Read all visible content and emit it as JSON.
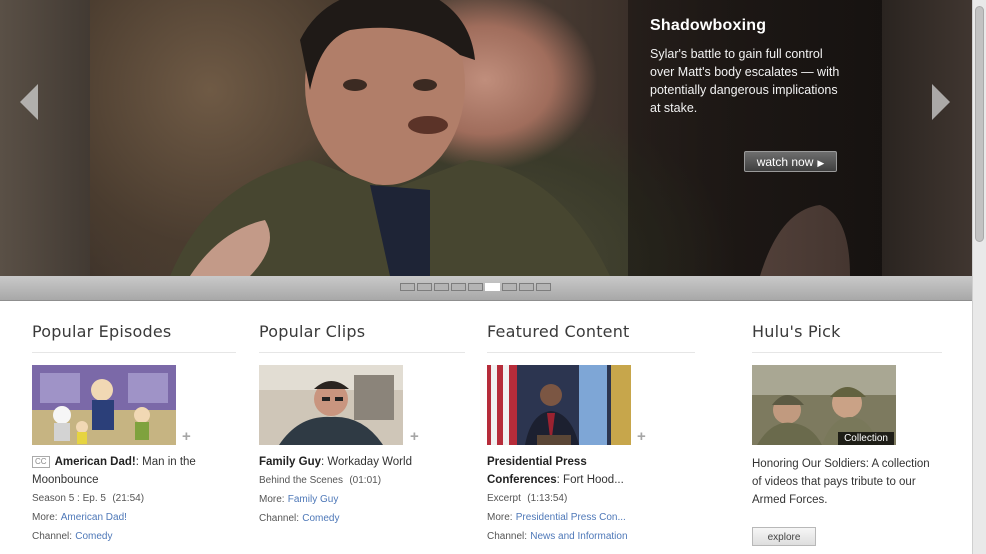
{
  "hero": {
    "title": "Shadowboxing",
    "description": "Sylar's battle to gain full control over Matt's body escalates — with potentially dangerous implications at stake.",
    "watch_label": "watch now",
    "watch_icon": "play-triangle-icon",
    "slides_count": 9,
    "active_slide": 6
  },
  "sections": {
    "popular_episodes": {
      "heading": "Popular Episodes",
      "cc_label": "CC",
      "show": "American Dad!",
      "episode_title": ": Man in the Moonbounce",
      "season_ep": "Season 5 : Ep. 5",
      "duration": "(21:54)",
      "more_label": "More:",
      "more_link": "American Dad!",
      "channel_label": "Channel:",
      "channel_link": "Comedy"
    },
    "popular_clips": {
      "heading": "Popular Clips",
      "show": "Family Guy",
      "clip_title": ": Workaday World",
      "clip_type": "Behind the Scenes",
      "duration": "(01:01)",
      "more_label": "More:",
      "more_link": "Family Guy",
      "channel_label": "Channel:",
      "channel_link": "Comedy"
    },
    "featured_content": {
      "heading": "Featured Content",
      "show": "Presidential Press Conferences",
      "item_title": ": Fort Hood...",
      "item_type": "Excerpt",
      "duration": "(1:13:54)",
      "more_label": "More:",
      "more_link": "Presidential Press Con...",
      "channel_label": "Channel:",
      "channel_link": "News and Information"
    },
    "hulus_pick": {
      "heading": "Hulu's Pick",
      "tag": "Collection",
      "description": "Honoring Our Soldiers: A collection of videos that pays tribute to our Armed Forces.",
      "button_label": "explore"
    }
  },
  "colors": {
    "link": "#4e78b8",
    "heading": "#3a3a3a"
  }
}
